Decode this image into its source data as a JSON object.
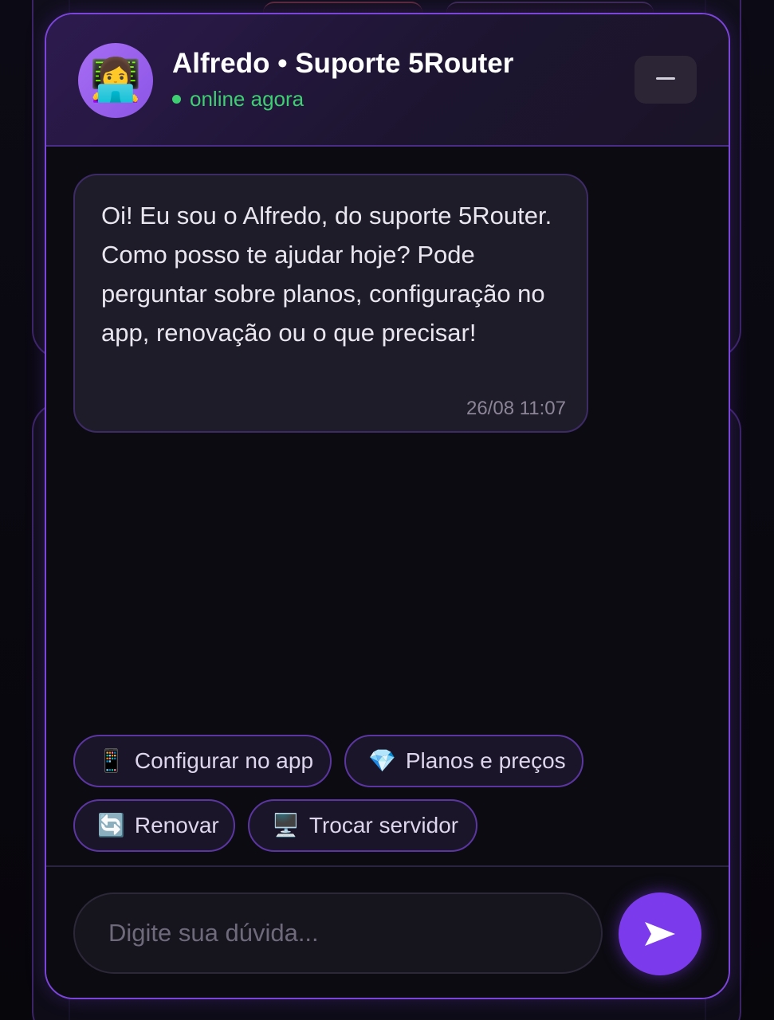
{
  "header": {
    "avatar_icon": "woman-technologist-emoji",
    "avatar_glyph": "👩‍💻",
    "agent_name": "Alfredo • Suporte 5Router",
    "status_text": "online agora",
    "minimize_icon": "minus-icon"
  },
  "messages": [
    {
      "sender": "agent",
      "text": "Oi! Eu sou o Alfredo, do suporte 5Router. Como posso te ajudar hoje? Pode perguntar sobre planos, configuração no app, renovação ou o que precisar!",
      "time": "26/08 11:07"
    }
  ],
  "quick_replies": [
    {
      "icon": "mobile-phone-icon",
      "glyph": "📱",
      "label": "Configurar no app"
    },
    {
      "icon": "gem-icon",
      "glyph": "💎",
      "label": "Planos e preços"
    },
    {
      "icon": "refresh-icon",
      "glyph": "🔄",
      "label": "Renovar"
    },
    {
      "icon": "desktop-computer-icon",
      "glyph": "🖥️",
      "label": "Trocar servidor"
    }
  ],
  "composer": {
    "placeholder": "Digite sua dúvida...",
    "send_icon": "send-arrow-icon"
  },
  "colors": {
    "accent": "#7c3aed",
    "online": "#3ecf72",
    "border": "#7a45d8",
    "background": "#0c0b11"
  }
}
